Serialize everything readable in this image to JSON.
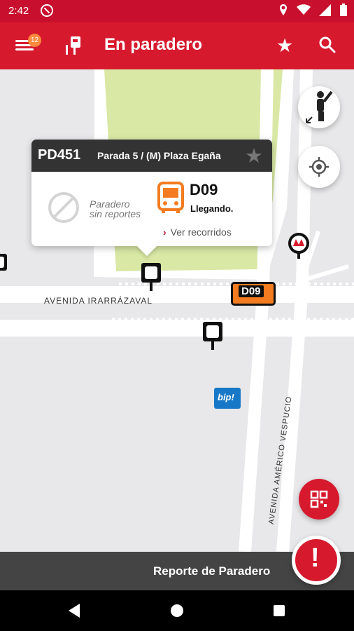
{
  "status_bar": {
    "time": "2:42"
  },
  "app_bar": {
    "title": "En paradero",
    "notification_count": "12"
  },
  "map": {
    "street_labels": [
      "AVENIDA IRARRÁZAVAL",
      "AVENIDA AMÉRICO VESPUCIO"
    ],
    "bus_marker_route": "D09",
    "bip_label": "bip!"
  },
  "popup": {
    "stop_code": "PD451",
    "stop_name": "Parada 5 / (M) Plaza Egaña",
    "no_report_line1": "Paradero",
    "no_report_line2": "sin reportes",
    "route": "D09",
    "arrival_status": "Llegando.",
    "routes_link": "Ver recorridos"
  },
  "footer": {
    "label": "Reporte de Paradero"
  },
  "colors": {
    "brand_red": "#d7192e",
    "bus_orange": "#f47c20",
    "park_green": "#d9e8a5"
  }
}
